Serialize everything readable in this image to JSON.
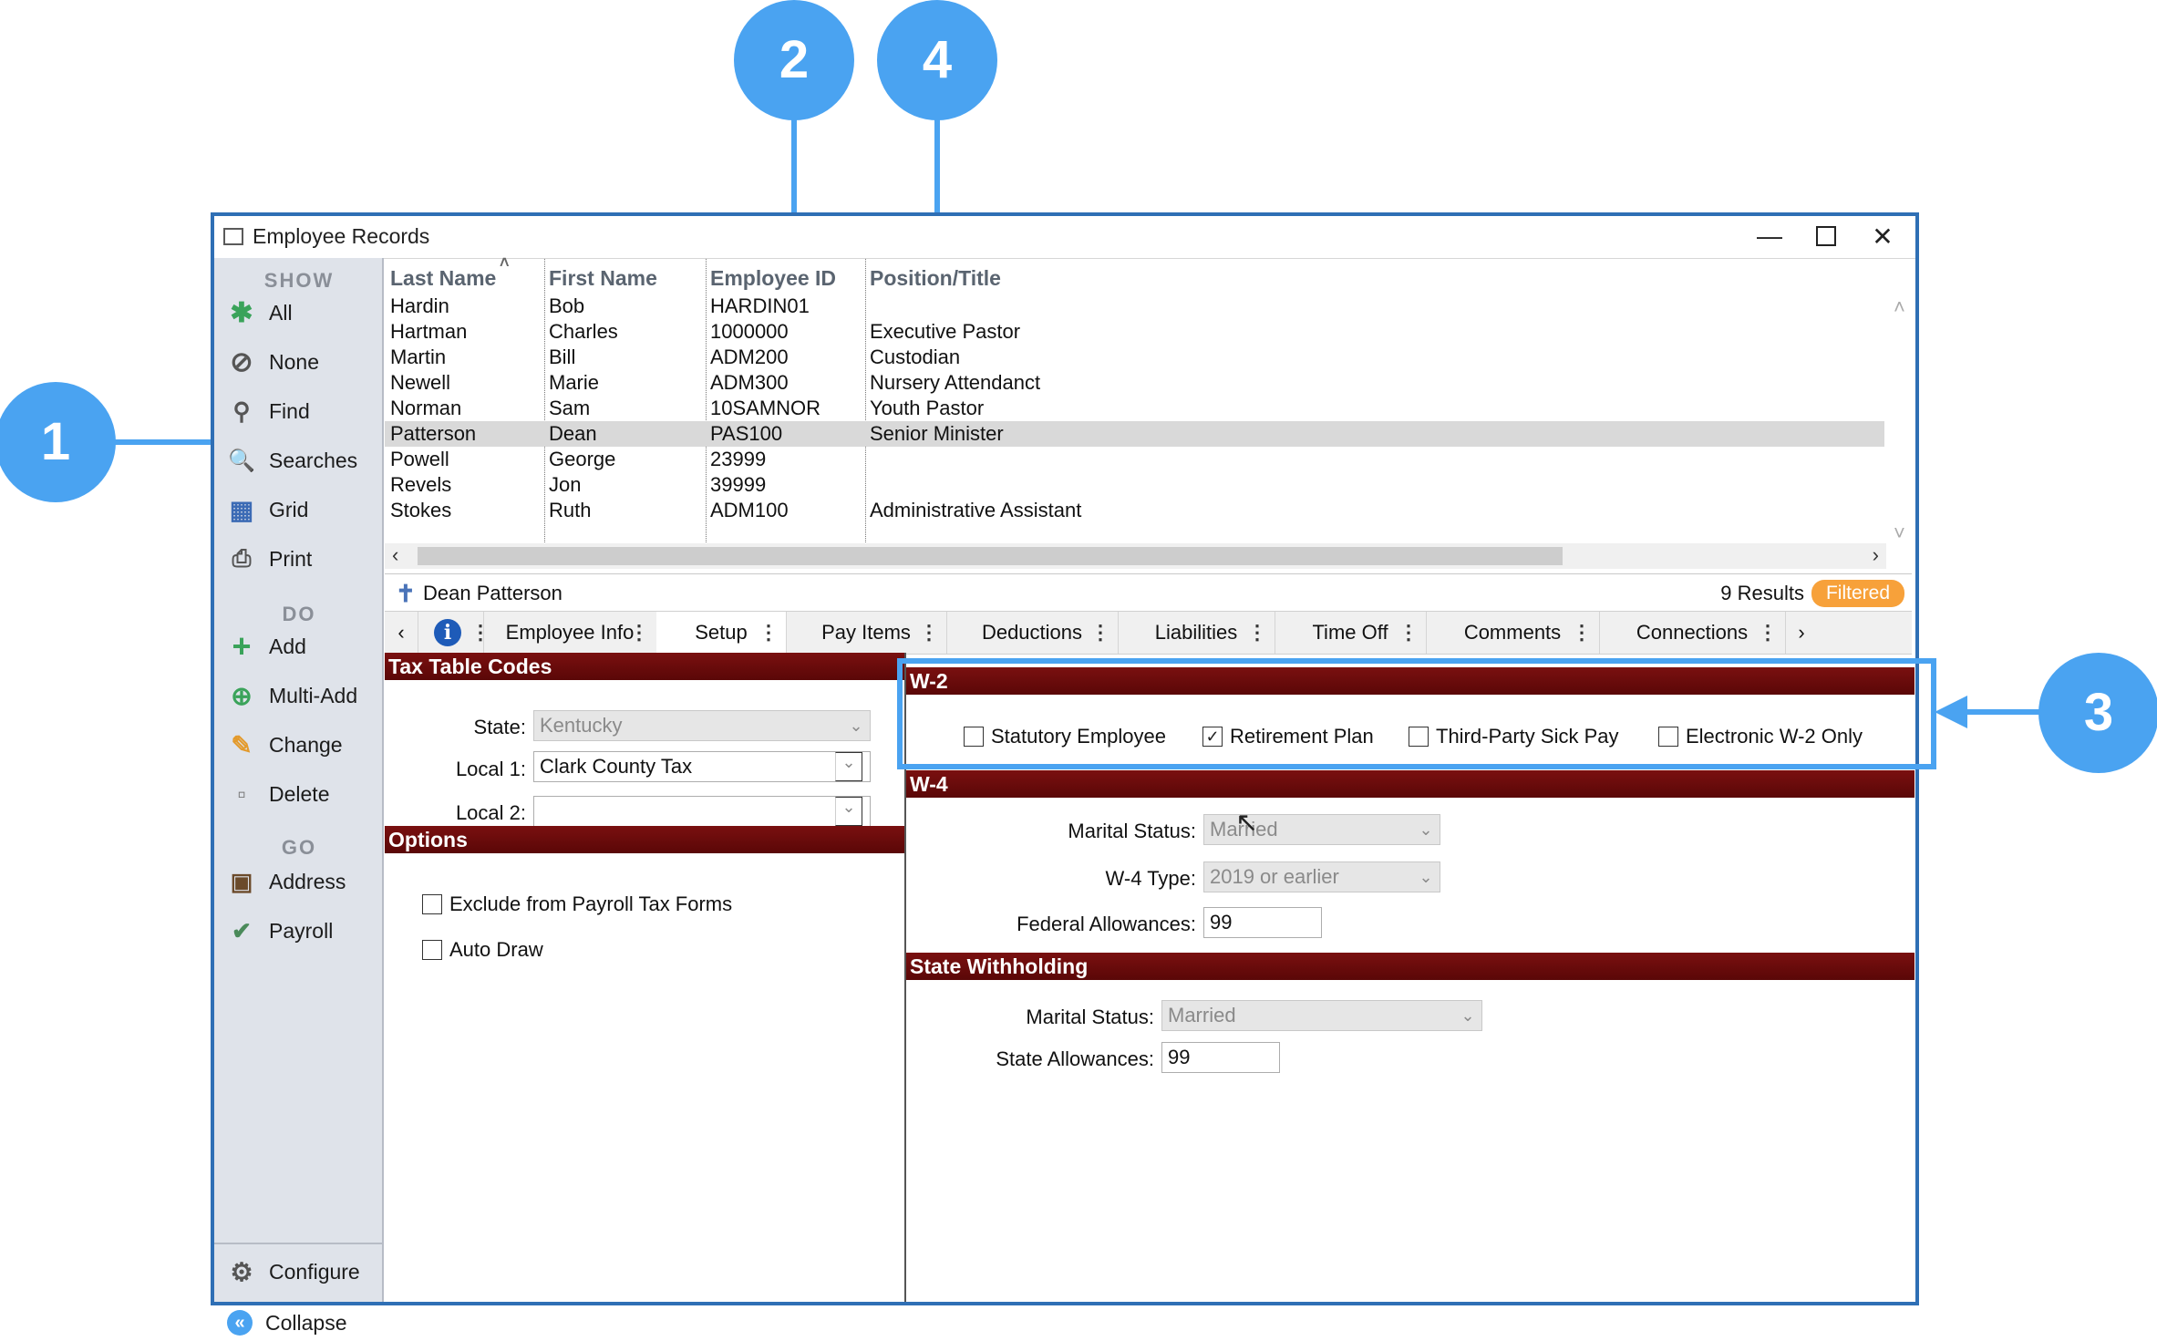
{
  "window": {
    "title": "Employee Records"
  },
  "sidebar": {
    "show_header": "SHOW",
    "do_header": "DO",
    "go_header": "GO",
    "show_items": [
      {
        "label": "All",
        "icon": "asterisk-icon"
      },
      {
        "label": "None",
        "icon": "none-icon"
      },
      {
        "label": "Find",
        "icon": "find-icon"
      },
      {
        "label": "Searches",
        "icon": "searches-icon"
      },
      {
        "label": "Grid",
        "icon": "grid-icon"
      },
      {
        "label": "Print",
        "icon": "printer-icon"
      }
    ],
    "do_items": [
      {
        "label": "Add",
        "icon": "plus-icon"
      },
      {
        "label": "Multi-Add",
        "icon": "multi-add-icon"
      },
      {
        "label": "Change",
        "icon": "pencil-icon"
      },
      {
        "label": "Delete",
        "icon": "trash-icon"
      }
    ],
    "go_items": [
      {
        "label": "Address",
        "icon": "address-book-icon"
      },
      {
        "label": "Payroll",
        "icon": "payroll-icon"
      }
    ],
    "bottom_items": [
      {
        "label": "Configure",
        "icon": "gear-icon"
      },
      {
        "label": "Collapse",
        "icon": "collapse-icon"
      }
    ]
  },
  "grid": {
    "columns": [
      "Last Name",
      "First Name",
      "Employee ID",
      "Position/Title"
    ],
    "rows": [
      {
        "last": "Hardin",
        "first": "Bob",
        "id": "HARDIN01",
        "title": ""
      },
      {
        "last": "Hartman",
        "first": "Charles",
        "id": "1000000",
        "title": "Executive Pastor"
      },
      {
        "last": "Martin",
        "first": "Bill",
        "id": "ADM200",
        "title": "Custodian"
      },
      {
        "last": "Newell",
        "first": "Marie",
        "id": "ADM300",
        "title": "Nursery Attendanct"
      },
      {
        "last": "Norman",
        "first": "Sam",
        "id": "10SAMNOR",
        "title": "Youth Pastor"
      },
      {
        "last": "Patterson",
        "first": "Dean",
        "id": "PAS100",
        "title": "Senior Minister"
      },
      {
        "last": "Powell",
        "first": "George",
        "id": "23999",
        "title": ""
      },
      {
        "last": "Revels",
        "first": "Jon",
        "id": "39999",
        "title": ""
      },
      {
        "last": "Stokes",
        "first": "Ruth",
        "id": "ADM100",
        "title": "Administrative Assistant"
      }
    ],
    "selected_index": 5
  },
  "status": {
    "person": "Dean Patterson",
    "results": "9 Results",
    "filter_badge": "Filtered"
  },
  "tabs": [
    "Employee Info",
    "Setup",
    "Pay Items",
    "Deductions",
    "Liabilities",
    "Time Off",
    "Comments",
    "Connections"
  ],
  "active_tab": "Setup",
  "tax_table": {
    "header": "Tax Table Codes",
    "state_label": "State:",
    "state_value": "Kentucky",
    "local1_label": "Local 1:",
    "local1_value": "Clark County Tax",
    "local2_label": "Local 2:",
    "local2_value": ""
  },
  "options": {
    "header": "Options",
    "exclude_label": "Exclude from Payroll Tax Forms",
    "exclude_checked": false,
    "autodraw_label": "Auto Draw",
    "autodraw_checked": false
  },
  "w2": {
    "header": "W-2",
    "statutory_label": "Statutory Employee",
    "statutory_checked": false,
    "retirement_label": "Retirement Plan",
    "retirement_checked": true,
    "sickpay_label": "Third-Party Sick Pay",
    "sickpay_checked": false,
    "electronic_label": "Electronic W-2 Only",
    "electronic_checked": false
  },
  "w4": {
    "header": "W-4",
    "marital_label": "Marital Status:",
    "marital_value": "Married",
    "type_label": "W-4 Type:",
    "type_value": "2019 or earlier",
    "allowances_label": "Federal Allowances:",
    "allowances_value": "99"
  },
  "state_withholding": {
    "header": "State Withholding",
    "marital_label": "Marital Status:",
    "marital_value": "Married",
    "allowances_label": "State Allowances:",
    "allowances_value": "99"
  },
  "callouts": [
    "1",
    "2",
    "3",
    "4"
  ],
  "colors": {
    "accent": "#4aa3f1",
    "section": "#6b0b0b",
    "badge": "#f7a13a"
  }
}
